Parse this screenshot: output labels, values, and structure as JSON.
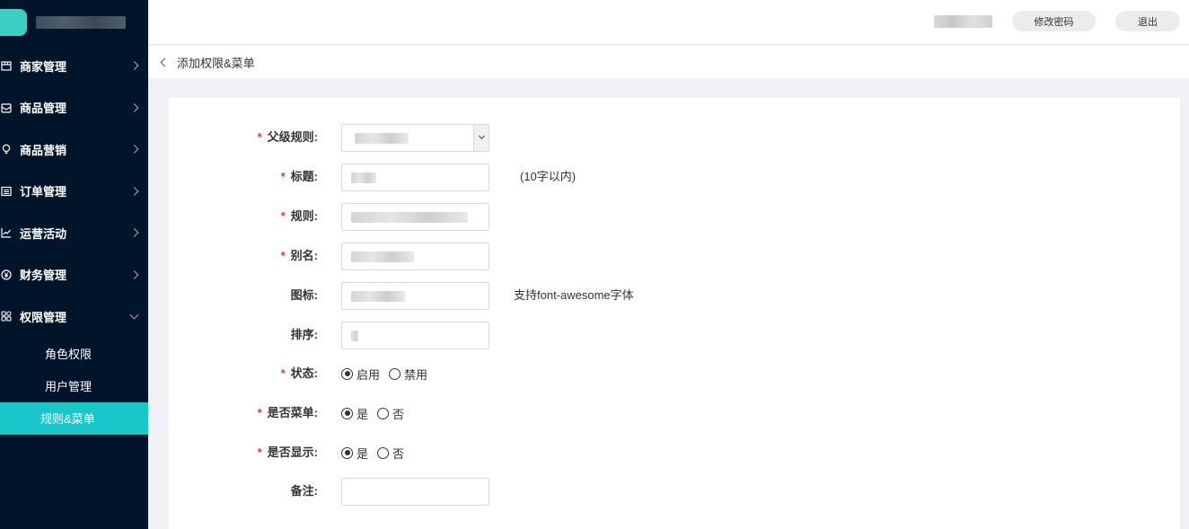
{
  "header": {
    "change_password_label": "修改密码",
    "logout_label": "退出"
  },
  "sidebar": {
    "items": [
      {
        "label": "商家管理",
        "icon": "shop-icon"
      },
      {
        "label": "商品管理",
        "icon": "box-icon"
      },
      {
        "label": "商品营销",
        "icon": "lightbulb-icon"
      },
      {
        "label": "订单管理",
        "icon": "list-icon"
      },
      {
        "label": "运营活动",
        "icon": "chart-line-icon"
      },
      {
        "label": "财务管理",
        "icon": "yen-circle-icon"
      },
      {
        "label": "权限管理",
        "icon": "grid-icon",
        "expanded": true
      }
    ],
    "sub_items": [
      {
        "label": "角色权限"
      },
      {
        "label": "用户管理"
      },
      {
        "label": "规则&菜单",
        "active": true
      }
    ]
  },
  "breadcrumb": {
    "title": "添加权限&菜单"
  },
  "form": {
    "parent_rule": {
      "label": "父级规则:"
    },
    "title": {
      "label": "标题:",
      "hint": "(10字以内)"
    },
    "rule": {
      "label": "规则:"
    },
    "alias": {
      "label": "别名:"
    },
    "icon": {
      "label": "图标:",
      "hint": "支持font-awesome字体"
    },
    "sort": {
      "label": "排序:"
    },
    "status": {
      "label": "状态:",
      "options": [
        "启用",
        "禁用"
      ],
      "selected": "启用"
    },
    "is_menu": {
      "label": "是否菜单:",
      "options": [
        "是",
        "否"
      ],
      "selected": "是"
    },
    "is_display": {
      "label": "是否显示:",
      "options": [
        "是",
        "否"
      ],
      "selected": "是"
    },
    "remark": {
      "label": "备注:"
    },
    "required_mark": "*"
  },
  "colors": {
    "sidebar_bg": "#001529",
    "active_bg": "#17c7c9",
    "required": "#e4393c"
  }
}
